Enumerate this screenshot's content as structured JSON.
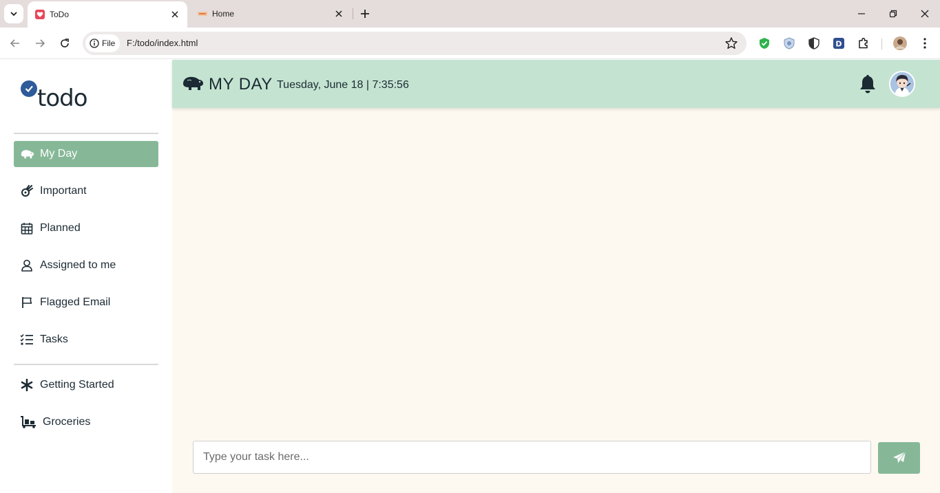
{
  "browser": {
    "tabs": [
      {
        "title": "ToDo",
        "active": true,
        "favicon": "heart-favicon-icon"
      },
      {
        "title": "Home",
        "active": false,
        "favicon": "site-favicon-icon"
      }
    ],
    "address": {
      "chip_label": "File",
      "url": "F:/todo/index.html"
    }
  },
  "app": {
    "logo_text": "todo",
    "nav": [
      {
        "label": "My Day",
        "icon": "hippo-icon",
        "active": true
      },
      {
        "label": "Important",
        "icon": "meteor-icon"
      },
      {
        "label": "Planned",
        "icon": "calendar-icon"
      },
      {
        "label": "Assigned to me",
        "icon": "user-icon"
      },
      {
        "label": "Flagged Email",
        "icon": "flag-icon"
      },
      {
        "label": "Tasks",
        "icon": "list-check-icon"
      }
    ],
    "lists": [
      {
        "label": "Getting Started",
        "icon": "asterisk-icon"
      },
      {
        "label": "Groceries",
        "icon": "dolly-icon"
      }
    ],
    "header": {
      "title": "MY DAY",
      "date": "Tuesday, June 18 | 7:35:56"
    },
    "task_input": {
      "placeholder": "Type your task here...",
      "value": ""
    }
  },
  "colors": {
    "accent": "#86b898",
    "header_bg": "#c4e4d1",
    "main_bg": "#fdf9f1",
    "text": "#1c2a33"
  }
}
